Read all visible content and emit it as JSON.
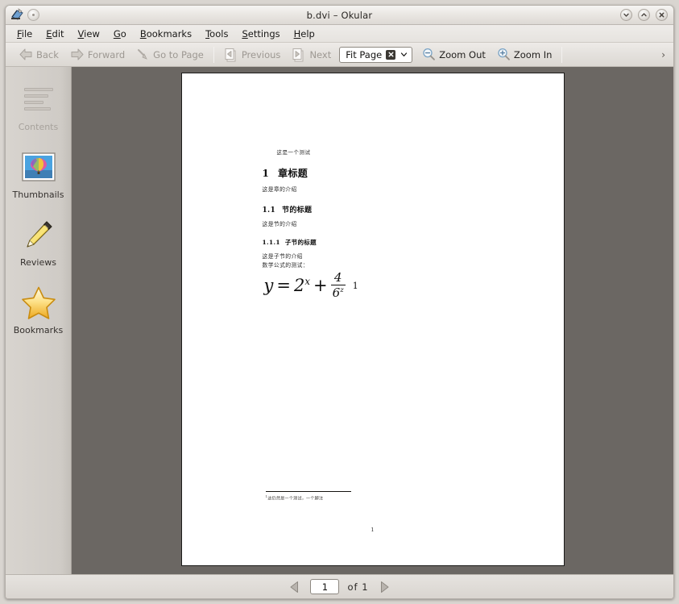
{
  "window": {
    "title": "b.dvi – Okular",
    "app_icon": "okular-icon",
    "controls": {
      "shade": "shade-button",
      "minimize": "minimize-button",
      "maximize": "maximize-button",
      "close": "close-button"
    }
  },
  "menubar": {
    "items": [
      {
        "label": "File",
        "accel": "F"
      },
      {
        "label": "Edit",
        "accel": "E"
      },
      {
        "label": "View",
        "accel": "V"
      },
      {
        "label": "Go",
        "accel": "G"
      },
      {
        "label": "Bookmarks",
        "accel": "B"
      },
      {
        "label": "Tools",
        "accel": "T"
      },
      {
        "label": "Settings",
        "accel": "S"
      },
      {
        "label": "Help",
        "accel": "H"
      }
    ]
  },
  "toolbar": {
    "back": "Back",
    "forward": "Forward",
    "go_to_page": "Go to Page",
    "previous": "Previous",
    "next": "Next",
    "zoom_value": "Fit Page",
    "zoom_out": "Zoom Out",
    "zoom_in": "Zoom In",
    "overflow": "›"
  },
  "sidebar": {
    "items": [
      {
        "label": "Contents",
        "icon": "contents-icon",
        "enabled": false
      },
      {
        "label": "Thumbnails",
        "icon": "thumbnail-icon",
        "enabled": true
      },
      {
        "label": "Reviews",
        "icon": "pencil-icon",
        "enabled": true
      },
      {
        "label": "Bookmarks",
        "icon": "star-icon",
        "enabled": true
      }
    ]
  },
  "document": {
    "header_line": "这是一个测试",
    "chapter": {
      "number": "1",
      "title": "章标题",
      "intro": "这是章的介绍"
    },
    "section": {
      "number": "1.1",
      "title": "节的标题",
      "intro": "这是节的介绍"
    },
    "subsection": {
      "number": "1.1.1",
      "title": "子节的标题",
      "intro": "这是子节的介绍",
      "formula_intro": "数学公式的测试："
    },
    "formula": {
      "lhs": "y",
      "equals": "=",
      "base": "2",
      "exponent": "x",
      "plus": "+",
      "numerator": "4",
      "denominator_base": "6",
      "denominator_exponent": "z",
      "footnote_marker": "1"
    },
    "footnote": {
      "marker": "1",
      "text": "这仍然是一个测试，一个脚注"
    },
    "page_number": "1"
  },
  "statusbar": {
    "prev_page": "previous-page-arrow",
    "current_page": "1",
    "of_label": "of  1",
    "next_page": "next-page-arrow"
  },
  "colors": {
    "viewer_background": "#6b6763",
    "page": "#ffffff",
    "chrome": "#e4e1dd",
    "disabled_text": "#9d9892"
  }
}
